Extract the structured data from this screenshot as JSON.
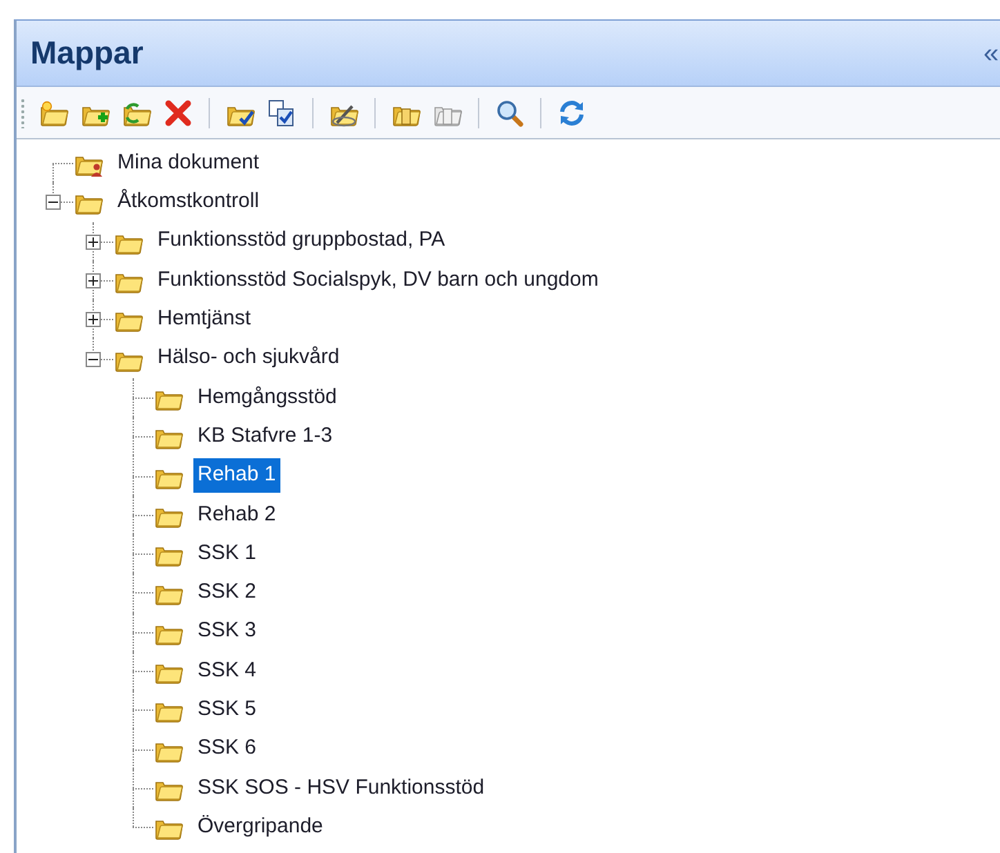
{
  "panel": {
    "title": "Mappar",
    "collapse_glyph": "«"
  },
  "toolbar": [
    {
      "kind": "button",
      "disabled": false
    },
    {
      "kind": "button",
      "disabled": false
    },
    {
      "kind": "button",
      "disabled": false
    },
    {
      "kind": "button",
      "disabled": false
    },
    {
      "kind": "separator"
    },
    {
      "kind": "button",
      "disabled": false
    },
    {
      "kind": "button",
      "disabled": false
    },
    {
      "kind": "separator"
    },
    {
      "kind": "button",
      "disabled": false
    },
    {
      "kind": "separator"
    },
    {
      "kind": "button",
      "disabled": false
    },
    {
      "kind": "button",
      "disabled": true
    },
    {
      "kind": "separator"
    },
    {
      "kind": "button",
      "disabled": false
    },
    {
      "kind": "separator"
    },
    {
      "kind": "button",
      "disabled": false
    }
  ],
  "tree": [
    {
      "label": "Mina dokument",
      "kind": "personal",
      "selected": false
    },
    {
      "label": "Åtkomstkontroll",
      "kind": "folder",
      "selected": false,
      "expanded": true,
      "children": [
        {
          "label": "Funktionsstöd gruppbostad, PA",
          "kind": "folder",
          "selected": false,
          "expanded": false
        },
        {
          "label": "Funktionsstöd Socialspyk, DV barn och ungdom",
          "kind": "folder",
          "selected": false,
          "expanded": false
        },
        {
          "label": "Hemtjänst",
          "kind": "folder",
          "selected": false,
          "expanded": false
        },
        {
          "label": "Hälso- och sjukvård",
          "kind": "folder",
          "selected": false,
          "expanded": true,
          "children": [
            {
              "label": "Hemgångsstöd",
              "kind": "folder",
              "selected": false
            },
            {
              "label": "KB Stafvre 1-3",
              "kind": "folder",
              "selected": false
            },
            {
              "label": "Rehab 1",
              "kind": "folder",
              "selected": true
            },
            {
              "label": "Rehab 2",
              "kind": "folder",
              "selected": false
            },
            {
              "label": "SSK 1",
              "kind": "folder",
              "selected": false
            },
            {
              "label": "SSK 2",
              "kind": "folder",
              "selected": false
            },
            {
              "label": "SSK 3",
              "kind": "folder",
              "selected": false
            },
            {
              "label": "SSK 4",
              "kind": "folder",
              "selected": false
            },
            {
              "label": "SSK 5",
              "kind": "folder",
              "selected": false
            },
            {
              "label": "SSK 6",
              "kind": "folder",
              "selected": false
            },
            {
              "label": "SSK SOS - HSV Funktionsstöd",
              "kind": "folder",
              "selected": false
            },
            {
              "label": "Övergripande",
              "kind": "folder",
              "selected": false
            }
          ]
        }
      ]
    }
  ]
}
